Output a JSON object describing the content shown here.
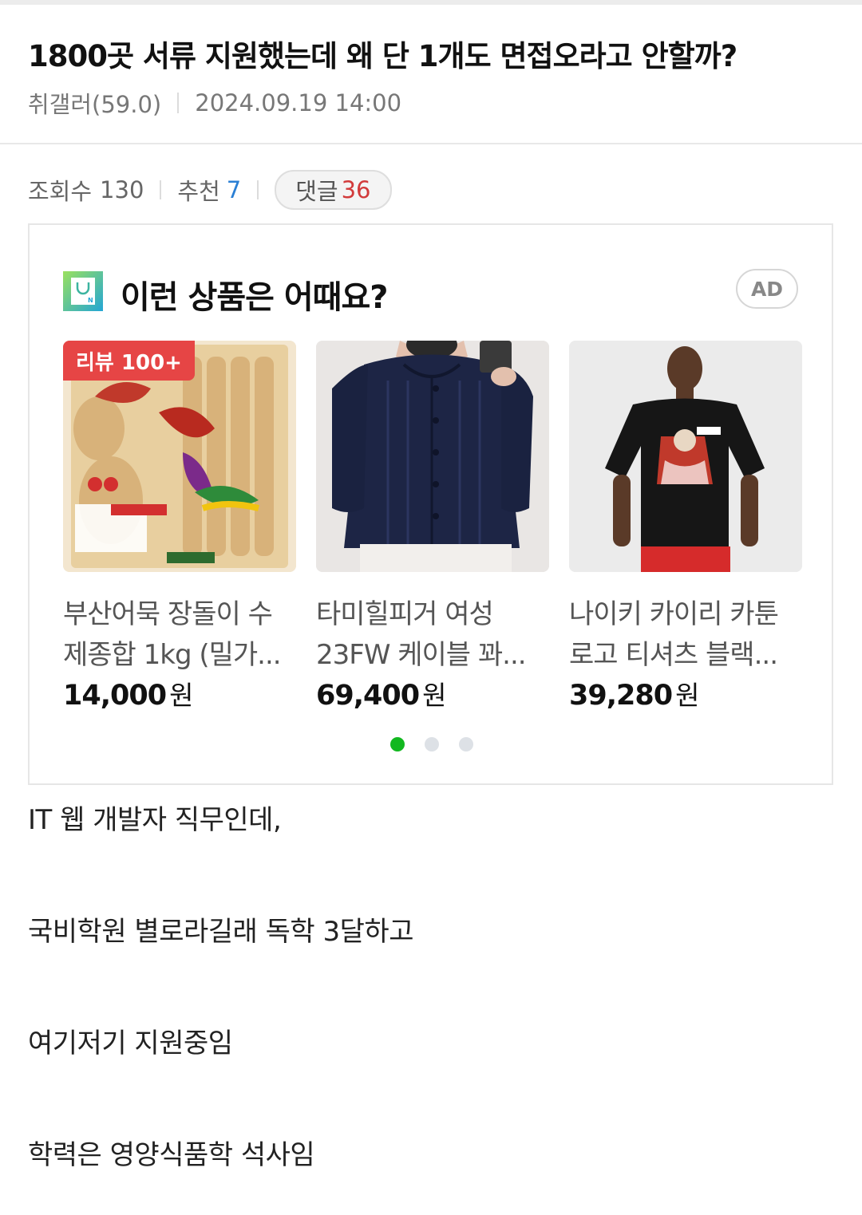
{
  "post": {
    "title": "1800곳 서류 지원했는데 왜 단 1개도 면접오라고 안할까?",
    "author": "취갤러(59.0)",
    "datetime": "2024.09.19 14:00",
    "views_label": "조회수",
    "views": "130",
    "recommend_label": "추천",
    "recommend": "7",
    "comments_label": "댓글",
    "comments": "36"
  },
  "ad": {
    "title": "이런 상품은 어때요?",
    "badge": "AD",
    "products": [
      {
        "name": "부산어묵 장돌이 수제종합 1kg (밀가...",
        "price": "14,000",
        "currency": "원",
        "badge": "리뷰 100+",
        "image": "fish-cake-package"
      },
      {
        "name": "타미힐피거 여성 23FW 케이블 꽈...",
        "price": "69,400",
        "currency": "원",
        "image": "navy-cable-cardigan"
      },
      {
        "name": "나이키 카이리 카툰 로고 티셔츠 블랙...",
        "price": "39,280",
        "currency": "원",
        "image": "black-graphic-tshirt"
      }
    ],
    "pagination": {
      "total": 3,
      "active": 1
    },
    "colors": {
      "badge": "#e64545",
      "dot_active": "#12b820"
    }
  },
  "body": {
    "lines": [
      "IT 웹 개발자 직무인데,",
      "국비학원 별로라길래 독학 3달하고",
      "여기저기 지원중임",
      "학력은 영양식품학 석사임"
    ]
  }
}
